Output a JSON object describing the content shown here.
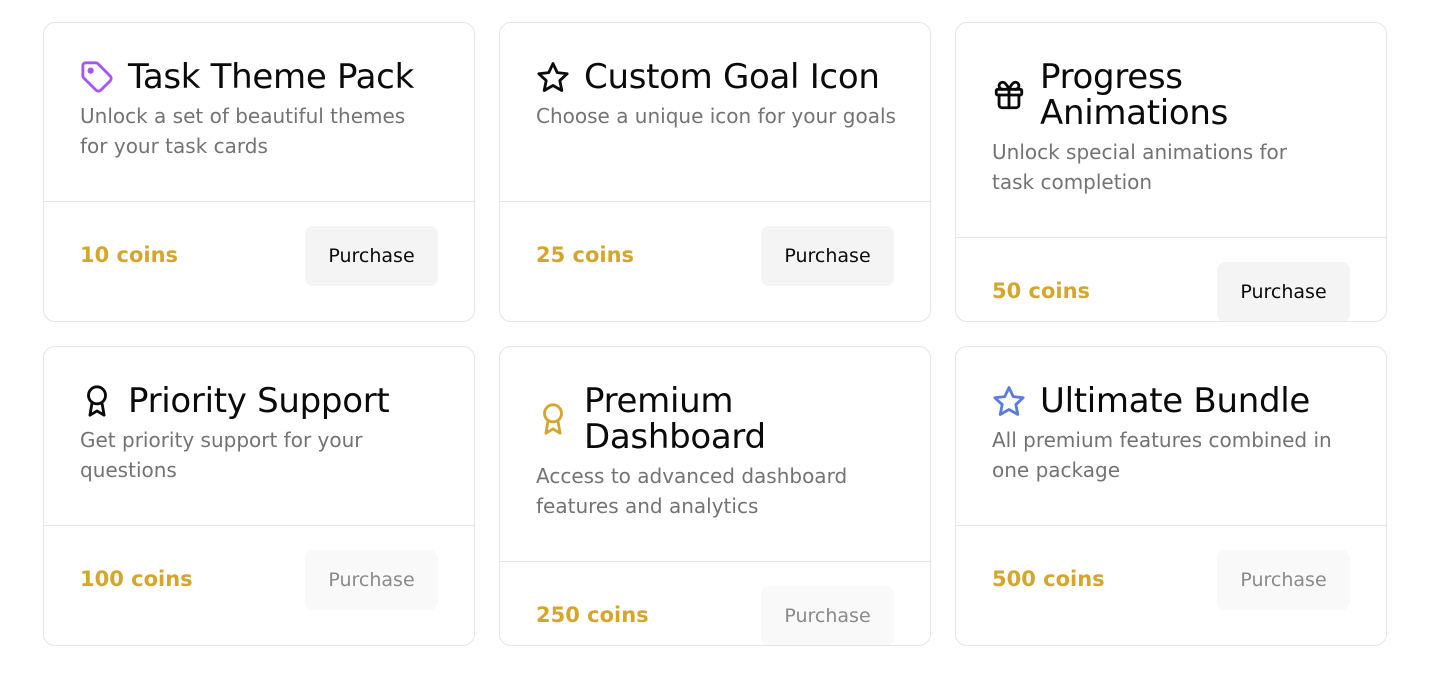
{
  "colors": {
    "accent_coins": "#d4a72c",
    "tag_icon": "#a855f7",
    "star_icon_dark": "#0a0a0a",
    "medal_icon": "#d4a72c",
    "star_icon_blue": "#5b7be0"
  },
  "items": [
    {
      "icon": "tag-icon",
      "title": "Task Theme Pack",
      "description": "Unlock a set of beautiful themes for your task cards",
      "price": "10 coins",
      "button_label": "Purchase",
      "enabled": true
    },
    {
      "icon": "star-icon",
      "title": "Custom Goal Icon",
      "description": "Choose a unique icon for your goals",
      "price": "25 coins",
      "button_label": "Purchase",
      "enabled": true
    },
    {
      "icon": "gift-icon",
      "title": "Progress Animations",
      "description": "Unlock special animations for task completion",
      "price": "50 coins",
      "button_label": "Purchase",
      "enabled": true
    },
    {
      "icon": "award-icon",
      "title": "Priority Support",
      "description": "Get priority support for your questions",
      "price": "100 coins",
      "button_label": "Purchase",
      "enabled": false
    },
    {
      "icon": "medal-icon",
      "title": "Premium Dashboard",
      "description": "Access to advanced dashboard features and analytics",
      "price": "250 coins",
      "button_label": "Purchase",
      "enabled": false
    },
    {
      "icon": "star-icon",
      "title": "Ultimate Bundle",
      "description": "All premium features combined in one package",
      "price": "500 coins",
      "button_label": "Purchase",
      "enabled": false
    }
  ]
}
